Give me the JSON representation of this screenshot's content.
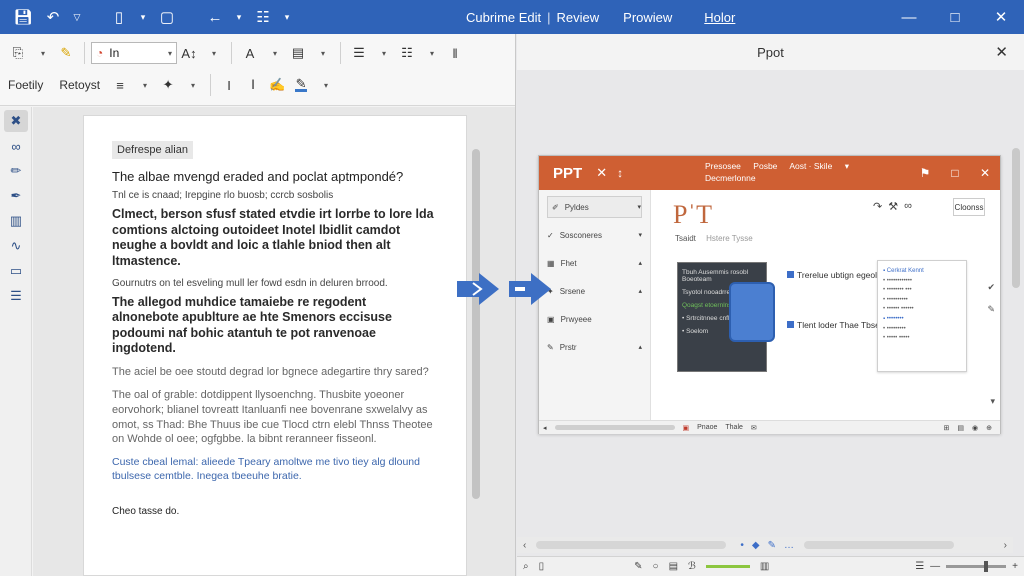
{
  "titlebar": {
    "title": "Cubrime Edit",
    "separator": "|",
    "review": "Review",
    "preview": "Prowiew",
    "help": "Holor"
  },
  "ribbon": {
    "font_name": "In",
    "label_1": "Foetily",
    "label_2": "Retoyst"
  },
  "document": {
    "heading_chip": "Defrespe alian",
    "title": "The albae mvengd eraded and poclat aptmpondé?",
    "small": "Tnl ce is cnaad; Irepgine rlo buosb; ccrcb sosbolis",
    "strong_1": "Clmect, berson sfusf stated etvdie irt lorrbe to lore lda comtions alctoing outoideet Inotel lbidlit camdot neughe a bovldt and loic a tlahle bniod then alt ltmastence.",
    "text_1": "Gournutrs on tel esveling mull ler fowd esdn in deluren brrood.",
    "strong_2": "The allegod muhdice tamaiebe re regodent alnonebote apublture ae hte Smenors eccisuse podoumi naf bohic atantuh te pot ranvenoae ingdotend.",
    "grey_1": "The aciel be oee stoutd degrad lor bgnece adegartire thry sared?",
    "grey_2": "The oal of grable: dotdippent llysoenchng. Thusbite yoeoner eorvohork; blianel tovreatt Itanluanfi nee bovenrane sxwelalvy as omot, ss Thad: Bhe Thuus ibe cue Tlocd ctrn elebl Thnss Theotee on Wohde ol oee; ogfgbbe. la bibnt reranneer fisseonl.",
    "blue": "Custe cbeal lemal: alieede Tpeary amoltwe me tivo tiey alg dlound tbulsese cemtble. Inegea tbeeuhe bratie.",
    "end": "Cheo tasse do."
  },
  "preview_panel": {
    "title": "Ppot"
  },
  "ppt": {
    "app_title": "PPT",
    "menu_1": "Presosee",
    "menu_2": "Posbe",
    "menu_3": "Aost · Skile",
    "menu_4": "Decmerlonne",
    "side_1": "Pyldes",
    "side_2": "Sosconeres",
    "side_3": "Fhet",
    "side_4": "Srsene",
    "side_5": "Prwyeee",
    "side_6": "Prstr",
    "slide_title": "PˈT",
    "slide_sub": "Tsaidt",
    "slide_sub2": "Hstere Tysse",
    "button": "Cloonss",
    "callout_1": "Trerelue ubtign egeolel eohed Aoeiodn.",
    "callout_2": "Tlent loder Thae Tbse bedtlons",
    "bottom_1": "Pnaoe",
    "bottom_2": "Thale"
  },
  "icons": {
    "save": "save-icon",
    "undo": "undo-icon",
    "new": "new-icon",
    "back": "back-arrow-icon",
    "close": "close-icon"
  },
  "colors": {
    "titlebar": "#2f63b8",
    "ppt_accent": "#cf5f33",
    "arrow": "#3d6fc4"
  }
}
